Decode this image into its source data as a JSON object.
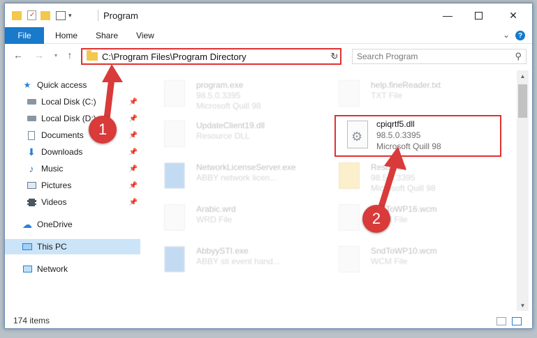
{
  "window": {
    "title": "Program"
  },
  "ribbon": {
    "file": "File",
    "home": "Home",
    "share": "Share",
    "view": "View",
    "help": "?"
  },
  "address": {
    "path": "C:\\Program Files\\Program Directory"
  },
  "search": {
    "placeholder": "Search Program"
  },
  "sidebar": {
    "items": [
      {
        "label": "Quick access",
        "icon": "star-icon",
        "pinned": false
      },
      {
        "label": "Local Disk (C:)",
        "icon": "drive-icon",
        "pinned": true
      },
      {
        "label": "Local Disk (D:)",
        "icon": "drive-icon",
        "pinned": true
      },
      {
        "label": "Documents",
        "icon": "documents-icon",
        "pinned": true
      },
      {
        "label": "Downloads",
        "icon": "download-icon",
        "pinned": true
      },
      {
        "label": "Music",
        "icon": "music-icon",
        "pinned": true
      },
      {
        "label": "Pictures",
        "icon": "pictures-icon",
        "pinned": true
      },
      {
        "label": "Videos",
        "icon": "videos-icon",
        "pinned": true
      },
      {
        "label": "OneDrive",
        "icon": "cloud-icon",
        "pinned": false
      },
      {
        "label": "This PC",
        "icon": "computer-icon",
        "pinned": false,
        "selected": true
      },
      {
        "label": "Network",
        "icon": "network-icon",
        "pinned": false
      }
    ]
  },
  "files": [
    {
      "name": "program.exe",
      "line2": "98.5.0.3395",
      "line3": "Microsoft Quill 98"
    },
    {
      "name": "help.fineReader.txt",
      "line2": "TXT File",
      "line3": ""
    },
    {
      "name": "UpdateClient19.dll",
      "line2": "Resource DLL",
      "line3": ""
    },
    {
      "name": "NetworkLicenseServer.exe",
      "line2": "ABBY network licen...",
      "line3": ""
    },
    {
      "name": "Resource",
      "line2": "98.5.0.3395",
      "line3": "Microsoft Quill 98"
    },
    {
      "name": "Arabic.wrd",
      "line2": "WRD File",
      "line3": ""
    },
    {
      "name": "SndToWP16.wcm",
      "line2": "WCM File",
      "line3": ""
    },
    {
      "name": "AbbyySTI.exe",
      "line2": "ABBY sti event hand...",
      "line3": ""
    },
    {
      "name": "SndToWP10.wcm",
      "line2": "WCM File",
      "line3": ""
    }
  ],
  "highlighted_file": {
    "name": "cpiqrtf5.dll",
    "version": "98.5.0.3395",
    "company": "Microsoft Quill 98"
  },
  "status": {
    "items": "174 items"
  },
  "markers": {
    "one": "1",
    "two": "2"
  },
  "colors": {
    "accent": "#1979ca",
    "annotation": "#e0312f"
  }
}
